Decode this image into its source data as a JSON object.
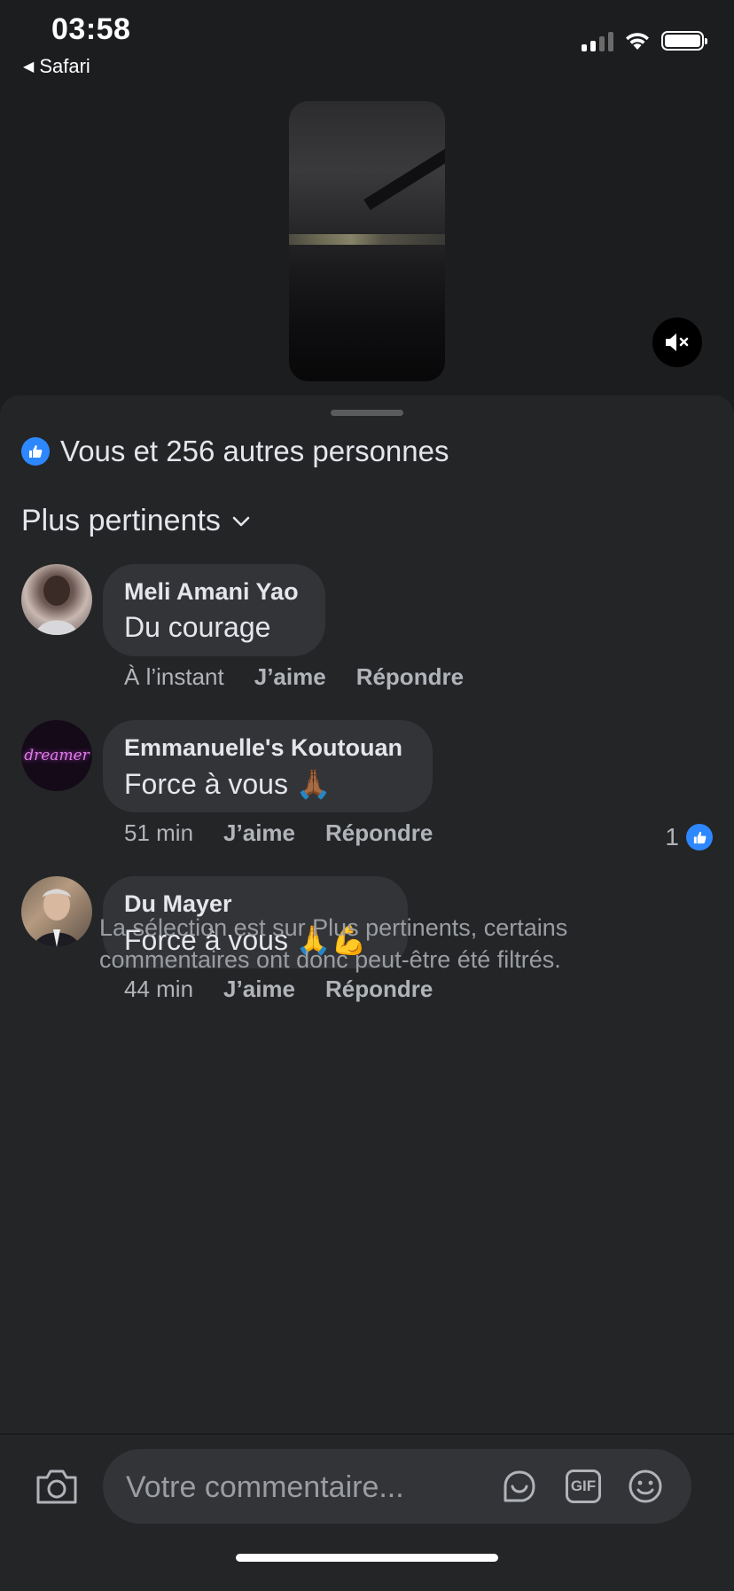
{
  "status_bar": {
    "time": "03:58",
    "back_app": "Safari",
    "back_arrow": "◀"
  },
  "video": {
    "mute_icon": "speaker-muted-icon"
  },
  "likes": {
    "text": "Vous et 256 autres personnes",
    "badge_color": "#2d88ff"
  },
  "sort": {
    "label": "Plus pertinents"
  },
  "comments": [
    {
      "author": "Meli Amani Yao",
      "text": "Du courage",
      "time": "À l’instant",
      "like_label": "J’aime",
      "reply_label": "Répondre"
    },
    {
      "author": "Emmanuelle's Koutouan",
      "text": "Force à vous 🙏🏾",
      "time": "51 min",
      "like_label": "J’aime",
      "reply_label": "Répondre",
      "reaction_count": "1"
    },
    {
      "author": "Du Mayer",
      "text": "Force à vous 🙏💪",
      "time": "44 min",
      "like_label": "J’aime",
      "reply_label": "Répondre"
    }
  ],
  "avatar_text": {
    "emmanuelle": "dreamer"
  },
  "filter_note": "La sélection est sur Plus pertinents, certains commentaires ont donc peut-être été filtrés.",
  "composer": {
    "placeholder": "Votre commentaire...",
    "gif_label": "GIF"
  },
  "colors": {
    "background": "#1c1d1f",
    "sheet": "#242527",
    "bubble": "#333437",
    "accent": "#2d88ff",
    "muted_text": "#b0b3b8"
  }
}
